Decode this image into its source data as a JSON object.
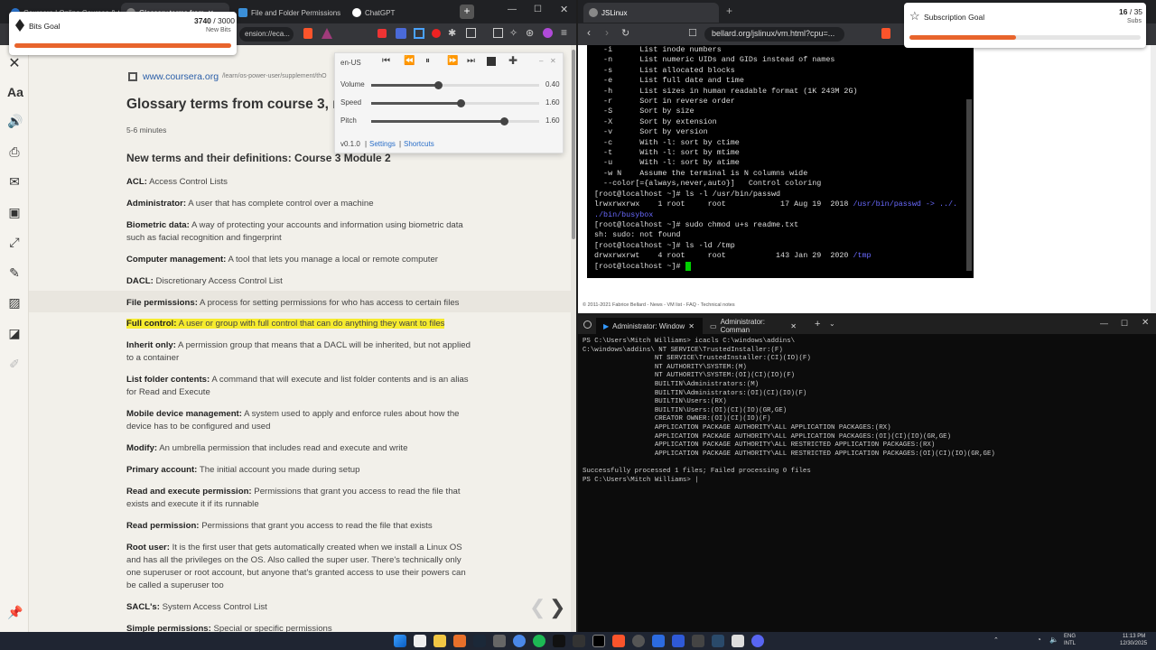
{
  "left_tabs": [
    {
      "label": "Coursera | Online Courses & C"
    },
    {
      "label": "Glossary terms from"
    },
    {
      "label": "File and Folder Permissions"
    },
    {
      "label": "ChatGPT"
    }
  ],
  "left_address": "ension://eca...",
  "bits_goal": {
    "title": "Bits Goal",
    "count": "3740",
    "total": "/ 3000",
    "sub": "New Bits",
    "progress": 1.0
  },
  "sub_goal": {
    "title": "Subscription Goal",
    "count": "16",
    "total": "/ 35",
    "sub": "Subs",
    "progress": 0.46
  },
  "media": {
    "lang": "en-US",
    "volume_label": "Volume",
    "volume": "0.40",
    "speed_label": "Speed",
    "speed": "1.60",
    "pitch_label": "Pitch",
    "pitch": "1.60",
    "version": "v0.1.0",
    "settings": "Settings",
    "shortcuts": "Shortcuts",
    "sep": "|",
    "volume_level": 0.4,
    "speed_level": 0.53,
    "pitch_level": 0.79
  },
  "page": {
    "site": "www.coursera.org",
    "path": "/learn/os-power-user/supplement/thO",
    "title": "Glossary terms from course 3, m",
    "read_time": "5-6 minutes",
    "heading": "New terms and their definitions: Course 3 Module 2",
    "terms": [
      {
        "term": "ACL:",
        "def": "Access Control Lists"
      },
      {
        "term": "Administrator:",
        "def": "A user that has complete control over a machine"
      },
      {
        "term": "Biometric data:",
        "def": "A way of protecting your accounts and information using biometric data such as facial recognition and fingerprint"
      },
      {
        "term": "Computer management:",
        "def": "A tool that lets you manage a local or remote computer"
      },
      {
        "term": "DACL:",
        "def": "Discretionary Access Control List"
      },
      {
        "term": "File permissions:",
        "def": "A process for setting permissions for who has access to certain files"
      },
      {
        "term": "Full control:",
        "def": "A user or group with full control that can do anything they want to files"
      },
      {
        "term": "Inherit only:",
        "def": "A permission group that means that a DACL will be inherited, but not applied to a container"
      },
      {
        "term": "List folder contents:",
        "def": "A command that will execute and list folder contents and is an alias for Read and Execute"
      },
      {
        "term": "Mobile device management:",
        "def": "A system used to apply and enforce rules about how the device has to be configured and used"
      },
      {
        "term": "Modify:",
        "def": "An umbrella permission that includes read and execute and write"
      },
      {
        "term": "Primary account:",
        "def": "The initial account you made during setup"
      },
      {
        "term": "Read and execute permission:",
        "def": "Permissions that grant you access to read the file that exists and execute it if its runnable"
      },
      {
        "term": "Read permission:",
        "def": "Permissions that grant you access to read the file that exists"
      },
      {
        "term": "Root user:",
        "def": "It is the first user that gets automatically created when we install a Linux OS and has all the privileges on the OS. Also called the super user. There's technically only one superuser or root account, but anyone that's granted access to use their powers can be called a superuser too"
      },
      {
        "term": "SACL's:",
        "def": "System Access Control List"
      },
      {
        "term": "Simple permissions:",
        "def": "Special or specific permissions"
      }
    ]
  },
  "right_tabs": [
    {
      "label": "JSLinux"
    }
  ],
  "right_address": "bellard.org/jslinux/vm.html?cpu=...",
  "jslinux": {
    "lines": [
      "  -i      List inode numbers",
      "  -n      List numeric UIDs and GIDs instead of names",
      "  -s      List allocated blocks",
      "  -e      List full date and time",
      "  -h      List sizes in human readable format (1K 243M 2G)",
      "  -r      Sort in reverse order",
      "  -S      Sort by size",
      "  -X      Sort by extension",
      "  -v      Sort by version",
      "  -c      With -l: sort by ctime",
      "  -t      With -l: sort by mtime",
      "  -u      With -l: sort by atime",
      "  -w N    Assume the terminal is N columns wide",
      "  --color[={always,never,auto}]   Control coloring",
      "[root@localhost ~]# ls -l /usr/bin/passwd",
      "lrwxrwxrwx    1 root     root            17 Aug 19  2018 ",
      "./bin/busybox",
      "[root@localhost ~]# sudo chmod u+s readme.txt",
      "sh: sudo: not found",
      "[root@localhost ~]# ls -ld /tmp",
      "drwxrwxrwt    4 root     root           143 Jan 29  2020 ",
      "[root@localhost ~]# "
    ],
    "passwd_link": "/usr/bin/passwd -> ../.",
    "tmp_link": "/tmp",
    "footer": "© 2011-2021 Fabrice Bellard - News - VM list - FAQ - Technical notes"
  },
  "wt": {
    "tab1": "Administrator: Window",
    "tab2": "Administrator: Comman",
    "output": "PS C:\\Users\\Mitch Williams> icacls C:\\windows\\addins\\\nC:\\windows\\addins\\ NT SERVICE\\TrustedInstaller:(F)\n                  NT SERVICE\\TrustedInstaller:(CI)(IO)(F)\n                  NT AUTHORITY\\SYSTEM:(M)\n                  NT AUTHORITY\\SYSTEM:(OI)(CI)(IO)(F)\n                  BUILTIN\\Administrators:(M)\n                  BUILTIN\\Administrators:(OI)(CI)(IO)(F)\n                  BUILTIN\\Users:(RX)\n                  BUILTIN\\Users:(OI)(CI)(IO)(GR,GE)\n                  CREATOR OWNER:(OI)(CI)(IO)(F)\n                  APPLICATION PACKAGE AUTHORITY\\ALL APPLICATION PACKAGES:(RX)\n                  APPLICATION PACKAGE AUTHORITY\\ALL APPLICATION PACKAGES:(OI)(CI)(IO)(GR,GE)\n                  APPLICATION PACKAGE AUTHORITY\\ALL RESTRICTED APPLICATION PACKAGES:(RX)\n                  APPLICATION PACKAGE AUTHORITY\\ALL RESTRICTED APPLICATION PACKAGES:(OI)(CI)(IO)(GR,GE)\n\nSuccessfully processed 1 files; Failed processing 0 files\nPS C:\\Users\\Mitch Williams> |"
  },
  "taskbar": {
    "lang1": "ENG",
    "lang2": "INTL",
    "time": "11:13 PM",
    "date": "12/30/2025"
  }
}
